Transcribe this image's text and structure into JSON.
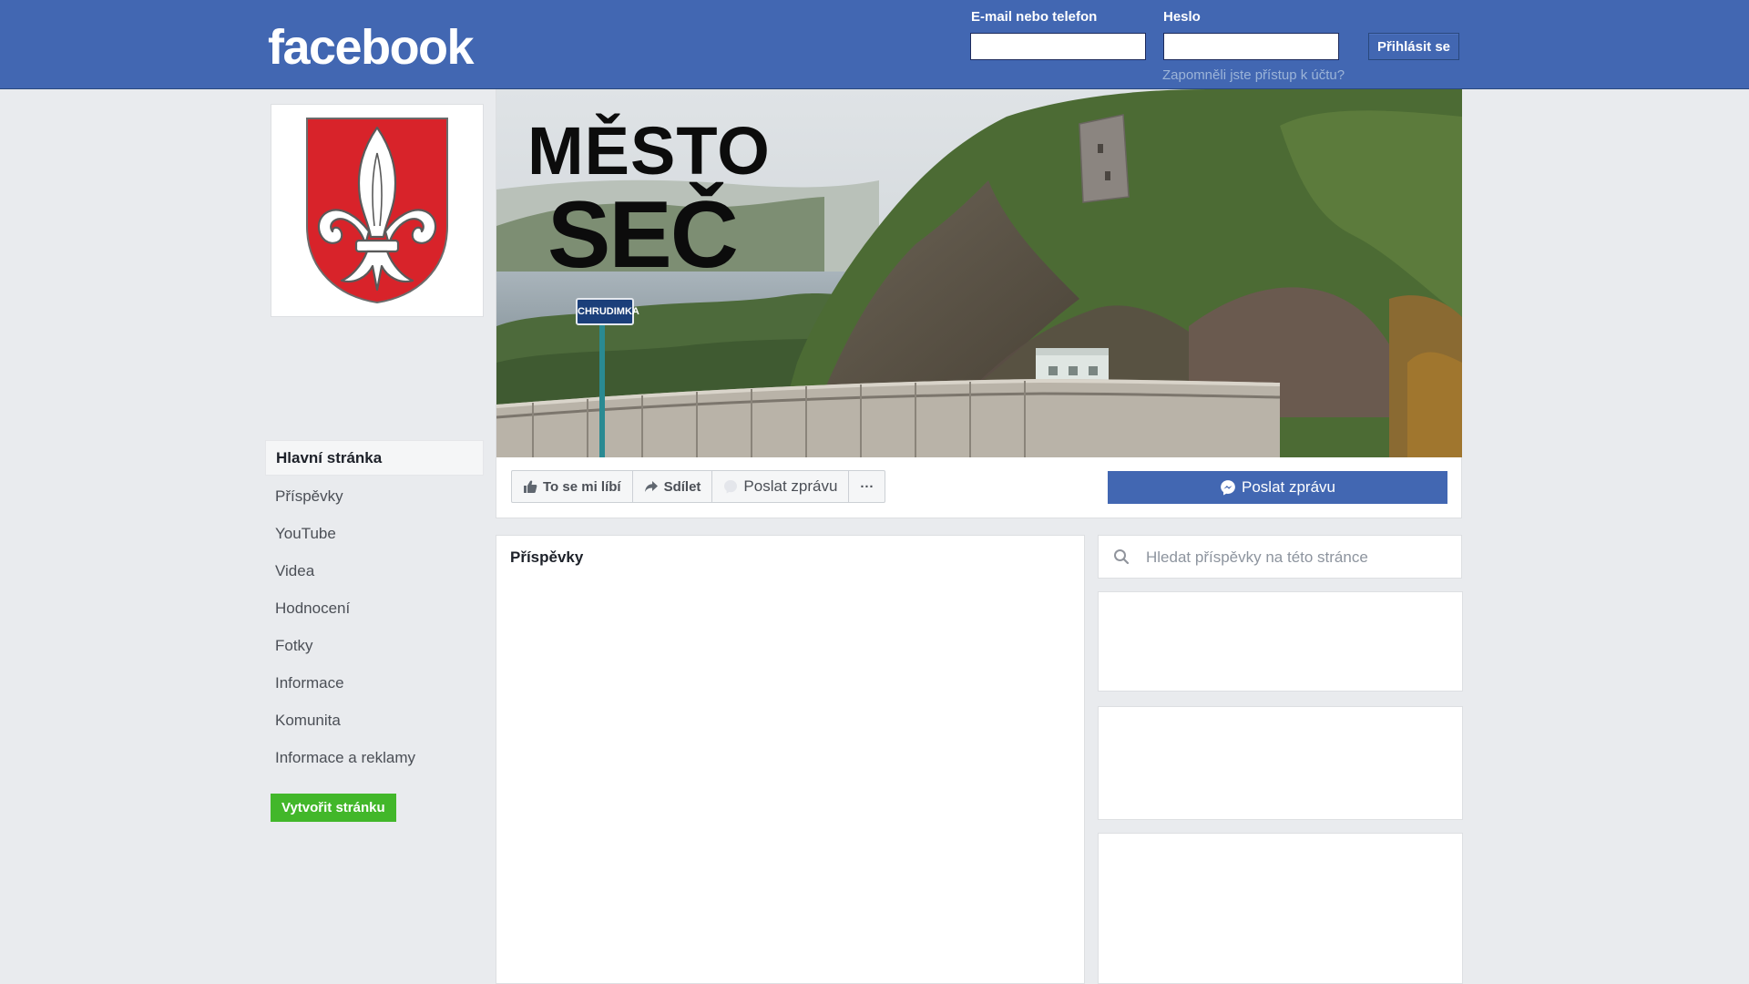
{
  "header": {
    "logo": "facebook",
    "email_label": "E-mail nebo telefon",
    "email_value": "",
    "password_label": "Heslo",
    "password_value": "",
    "login_button": "Přihlásit se",
    "forgot_link": "Zapomněli jste přístup k účtu?"
  },
  "cover": {
    "title_line1": "MĚSTO",
    "title_line2": "SEČ",
    "sign_text": "CHRUDIMKA"
  },
  "page_actions": {
    "like": "To se mi líbí",
    "share": "Sdílet",
    "message": "Poslat zprávu",
    "more": "···",
    "primary_message": "Poslat zprávu"
  },
  "sidebar": {
    "items": [
      {
        "label": "Hlavní stránka",
        "active": true
      },
      {
        "label": "Příspěvky",
        "active": false
      },
      {
        "label": "YouTube",
        "active": false
      },
      {
        "label": "Videa",
        "active": false
      },
      {
        "label": "Hodnocení",
        "active": false
      },
      {
        "label": "Fotky",
        "active": false
      },
      {
        "label": "Informace",
        "active": false
      },
      {
        "label": "Komunita",
        "active": false
      },
      {
        "label": "Informace a reklamy",
        "active": false
      }
    ],
    "create_page": "Vytvořit stránku"
  },
  "posts": {
    "title": "Příspěvky"
  },
  "search": {
    "placeholder": "Hledat příspěvky na této stránce"
  },
  "colors": {
    "brand": "#4267b2",
    "background": "#e9ebee",
    "create_page_green": "#42b72a",
    "coat_of_arms_red": "#d8232a"
  },
  "icons": {
    "like": "thumbs-up-icon",
    "share": "share-arrow-icon",
    "message": "messenger-icon",
    "search": "search-icon",
    "coat_of_arms": "fleur-de-lis-icon"
  }
}
